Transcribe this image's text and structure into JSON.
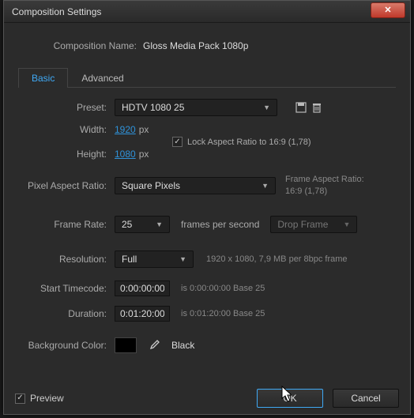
{
  "window": {
    "title": "Composition Settings"
  },
  "compName": {
    "label": "Composition Name:",
    "value": "Gloss Media Pack 1080p"
  },
  "tabs": {
    "basic": "Basic",
    "advanced": "Advanced"
  },
  "preset": {
    "label": "Preset:",
    "value": "HDTV 1080 25"
  },
  "width": {
    "label": "Width:",
    "value": "1920",
    "unit": "px"
  },
  "height": {
    "label": "Height:",
    "value": "1080",
    "unit": "px"
  },
  "lockAspect": {
    "label": "Lock Aspect Ratio to 16:9 (1,78)"
  },
  "par": {
    "label": "Pixel Aspect Ratio:",
    "value": "Square Pixels"
  },
  "far": {
    "label": "Frame Aspect Ratio:",
    "value": "16:9 (1,78)"
  },
  "frameRate": {
    "label": "Frame Rate:",
    "value": "25",
    "fpsLabel": "frames per second",
    "dropFrame": "Drop Frame"
  },
  "resolution": {
    "label": "Resolution:",
    "value": "Full",
    "info": "1920 x 1080, 7,9 MB per 8bpc frame"
  },
  "startTC": {
    "label": "Start Timecode:",
    "value": "0:00:00:00",
    "info": "is 0:00:00:00  Base 25"
  },
  "duration": {
    "label": "Duration:",
    "value": "0:01:20:00",
    "info": "is 0:01:20:00  Base 25"
  },
  "bgColor": {
    "label": "Background Color:",
    "name": "Black"
  },
  "footer": {
    "preview": "Preview",
    "ok": "OK",
    "cancel": "Cancel"
  }
}
